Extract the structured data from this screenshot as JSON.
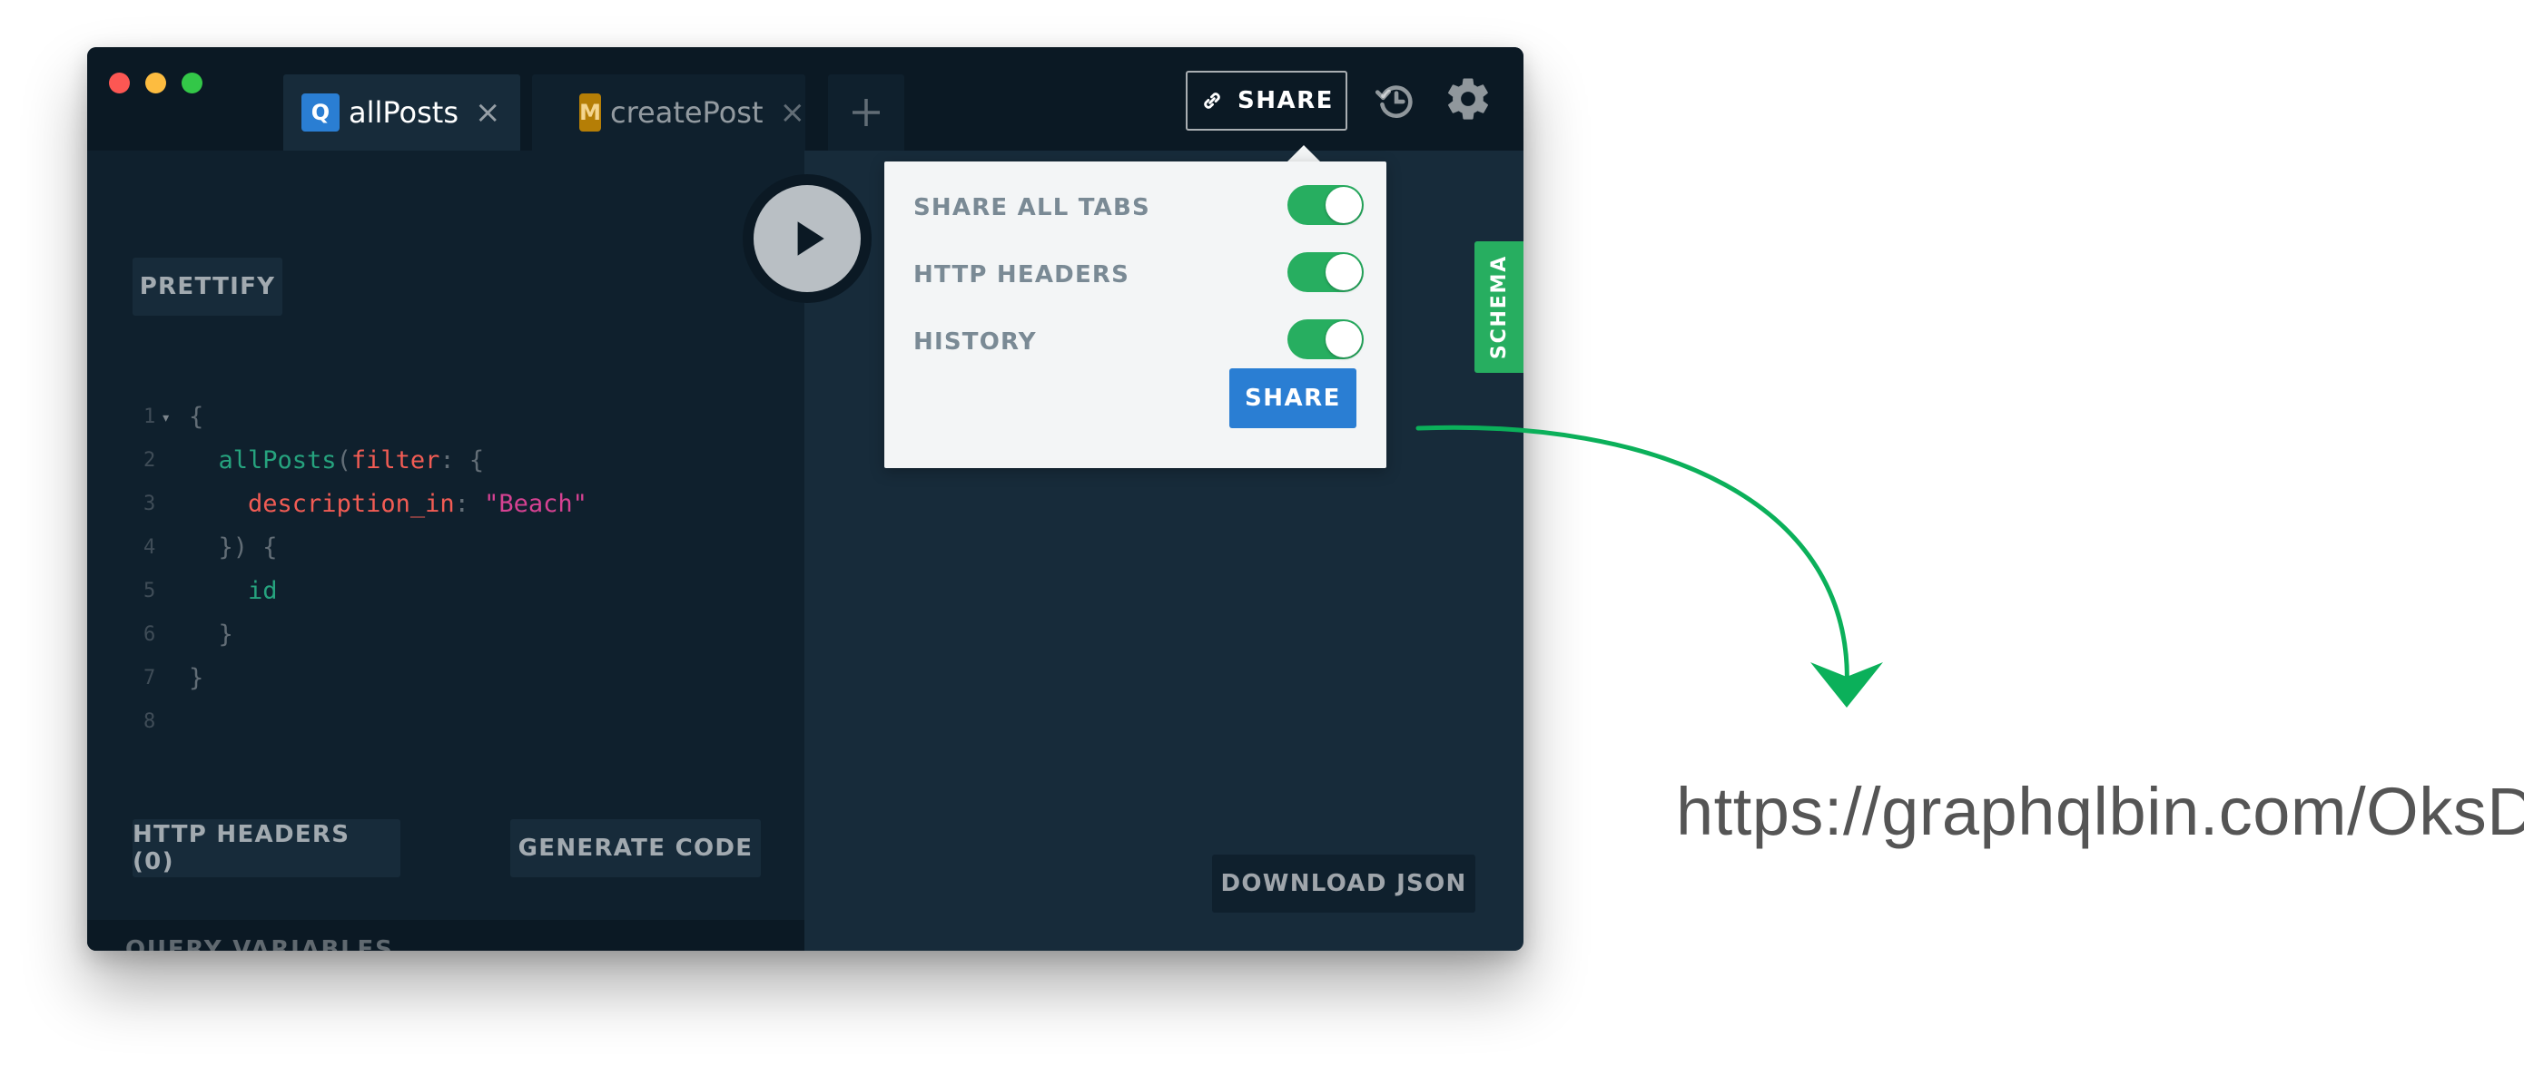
{
  "window": {
    "tabs": [
      {
        "badge": "Q",
        "label": "allPosts",
        "close": "×"
      },
      {
        "badge": "M",
        "label": "createPost",
        "close": "×"
      }
    ],
    "add_tab": "+",
    "share_button": "SHARE"
  },
  "editor": {
    "prettify": "PRETTIFY",
    "lines": [
      {
        "n": "1",
        "fold": "▾",
        "t0": "{"
      },
      {
        "n": "2",
        "t0": "  ",
        "field": "allPosts",
        "t1": "(",
        "arg": "filter",
        "t2": ": {"
      },
      {
        "n": "3",
        "t0": "    ",
        "arg": "description_in",
        "t1": ": ",
        "str": "\"Beach\""
      },
      {
        "n": "4",
        "t0": "  }) {"
      },
      {
        "n": "5",
        "t0": "    ",
        "field": "id"
      },
      {
        "n": "6",
        "t0": "  }"
      },
      {
        "n": "7",
        "t0": "}"
      },
      {
        "n": "8",
        "t0": ""
      }
    ],
    "http_headers": "HTTP HEADERS (0)",
    "generate_code": "GENERATE CODE",
    "query_variables": "QUERY VARIABLES"
  },
  "result": {
    "schema_tab": "SCHEMA",
    "download_json": "DOWNLOAD JSON"
  },
  "share_popover": {
    "options": [
      {
        "label": "SHARE ALL TABS",
        "on": true
      },
      {
        "label": "HTTP HEADERS",
        "on": true
      },
      {
        "label": "HISTORY",
        "on": true
      }
    ],
    "share_button": "SHARE"
  },
  "annotation": {
    "url": "https://graphqlbin.com/OksD",
    "arrow_color": "#0bb05a"
  },
  "colors": {
    "accent_green": "#27ae60",
    "accent_blue": "#2a7ed3",
    "query_badge": "#2a7ed3",
    "mutation_badge": "#b57e06"
  }
}
